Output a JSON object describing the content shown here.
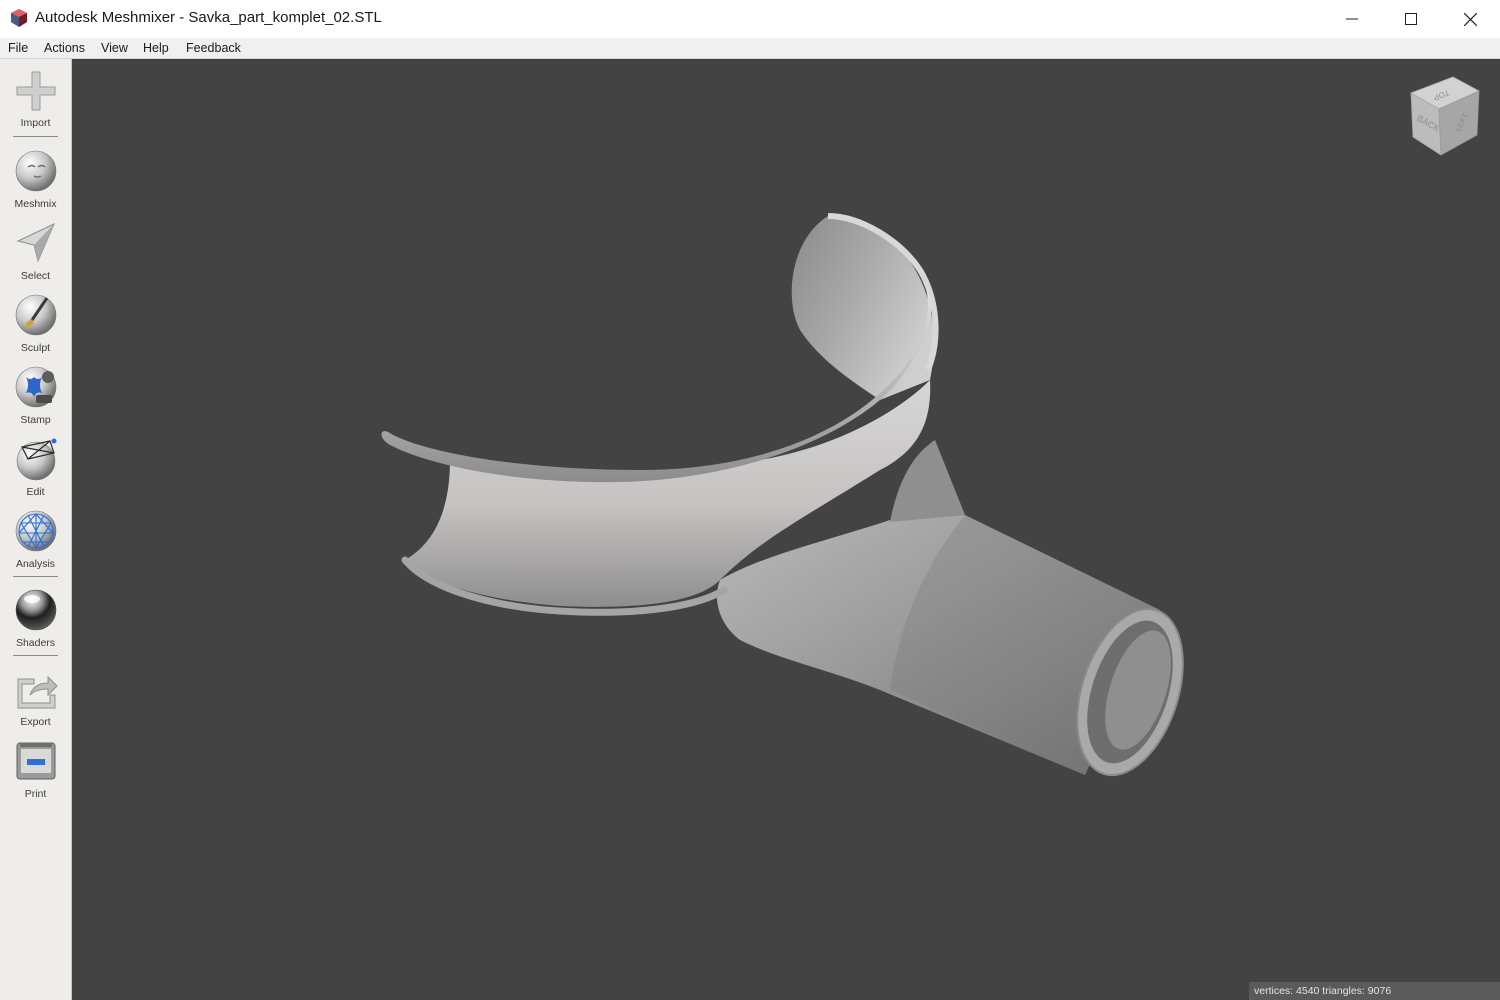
{
  "window": {
    "title": "Autodesk Meshmixer - Savka_part_komplet_02.STL",
    "controls": {
      "minimize_icon": "minimize-icon",
      "maximize_icon": "maximize-icon",
      "close_icon": "close-icon"
    }
  },
  "menu": {
    "items": [
      {
        "label": "File"
      },
      {
        "label": "Actions"
      },
      {
        "label": "View"
      },
      {
        "label": "Help"
      },
      {
        "label": "Feedback"
      }
    ]
  },
  "toolbar": {
    "tools": [
      {
        "label": "Import",
        "icon": "import-icon"
      },
      {
        "label": "Meshmix",
        "icon": "meshmix-icon"
      },
      {
        "label": "Select",
        "icon": "select-icon"
      },
      {
        "label": "Sculpt",
        "icon": "sculpt-icon"
      },
      {
        "label": "Stamp",
        "icon": "stamp-icon"
      },
      {
        "label": "Edit",
        "icon": "edit-icon"
      },
      {
        "label": "Analysis",
        "icon": "analysis-icon"
      },
      {
        "label": "Shaders",
        "icon": "shaders-icon"
      },
      {
        "label": "Export",
        "icon": "export-icon"
      },
      {
        "label": "Print",
        "icon": "print-icon"
      }
    ]
  },
  "viewport": {
    "background": "#434343",
    "viewcube": {
      "faces": [
        "TOP",
        "BACK",
        "LEFT"
      ]
    },
    "status": "vertices: 4540 triangles: 9076"
  }
}
